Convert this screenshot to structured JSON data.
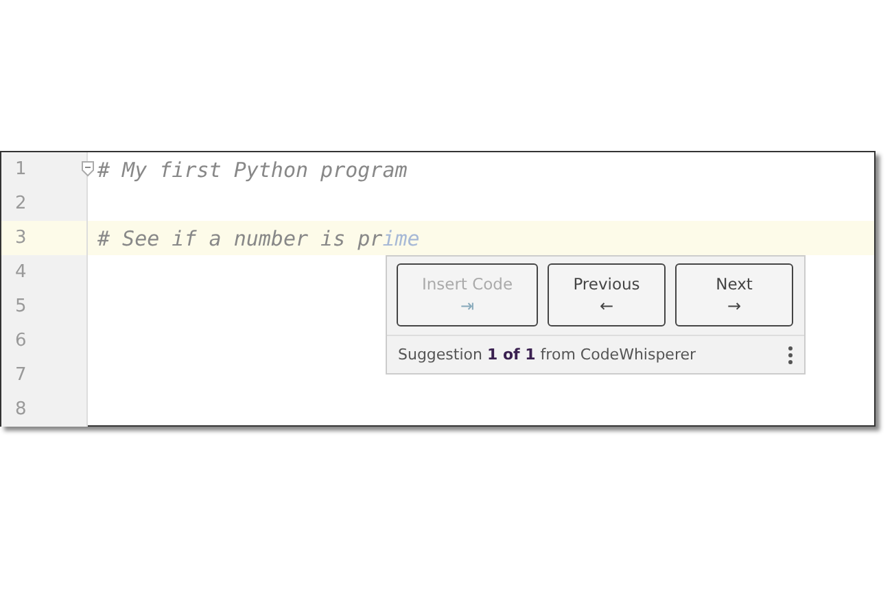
{
  "editor": {
    "lines": [
      {
        "number": "1",
        "text": "# My first Python program",
        "current": false,
        "foldable": true
      },
      {
        "number": "2",
        "current": false,
        "foldable": false
      },
      {
        "number": "3",
        "text": "# See if a number is pr",
        "ghost": "ime",
        "current": true,
        "foldable": false
      },
      {
        "number": "4",
        "current": false,
        "foldable": false
      },
      {
        "number": "5",
        "current": false,
        "foldable": false
      },
      {
        "number": "6",
        "current": false,
        "foldable": false
      },
      {
        "number": "7",
        "current": false,
        "foldable": false
      },
      {
        "number": "8",
        "current": false,
        "foldable": false
      }
    ]
  },
  "suggestion_popup": {
    "buttons": [
      {
        "label": "Insert Code",
        "key": "⇥",
        "disabled": true
      },
      {
        "label": "Previous",
        "key": "←",
        "disabled": false
      },
      {
        "label": "Next",
        "key": "→",
        "disabled": false
      }
    ],
    "status": "Suggestion **1 of 1** from CodeWhisperer"
  }
}
